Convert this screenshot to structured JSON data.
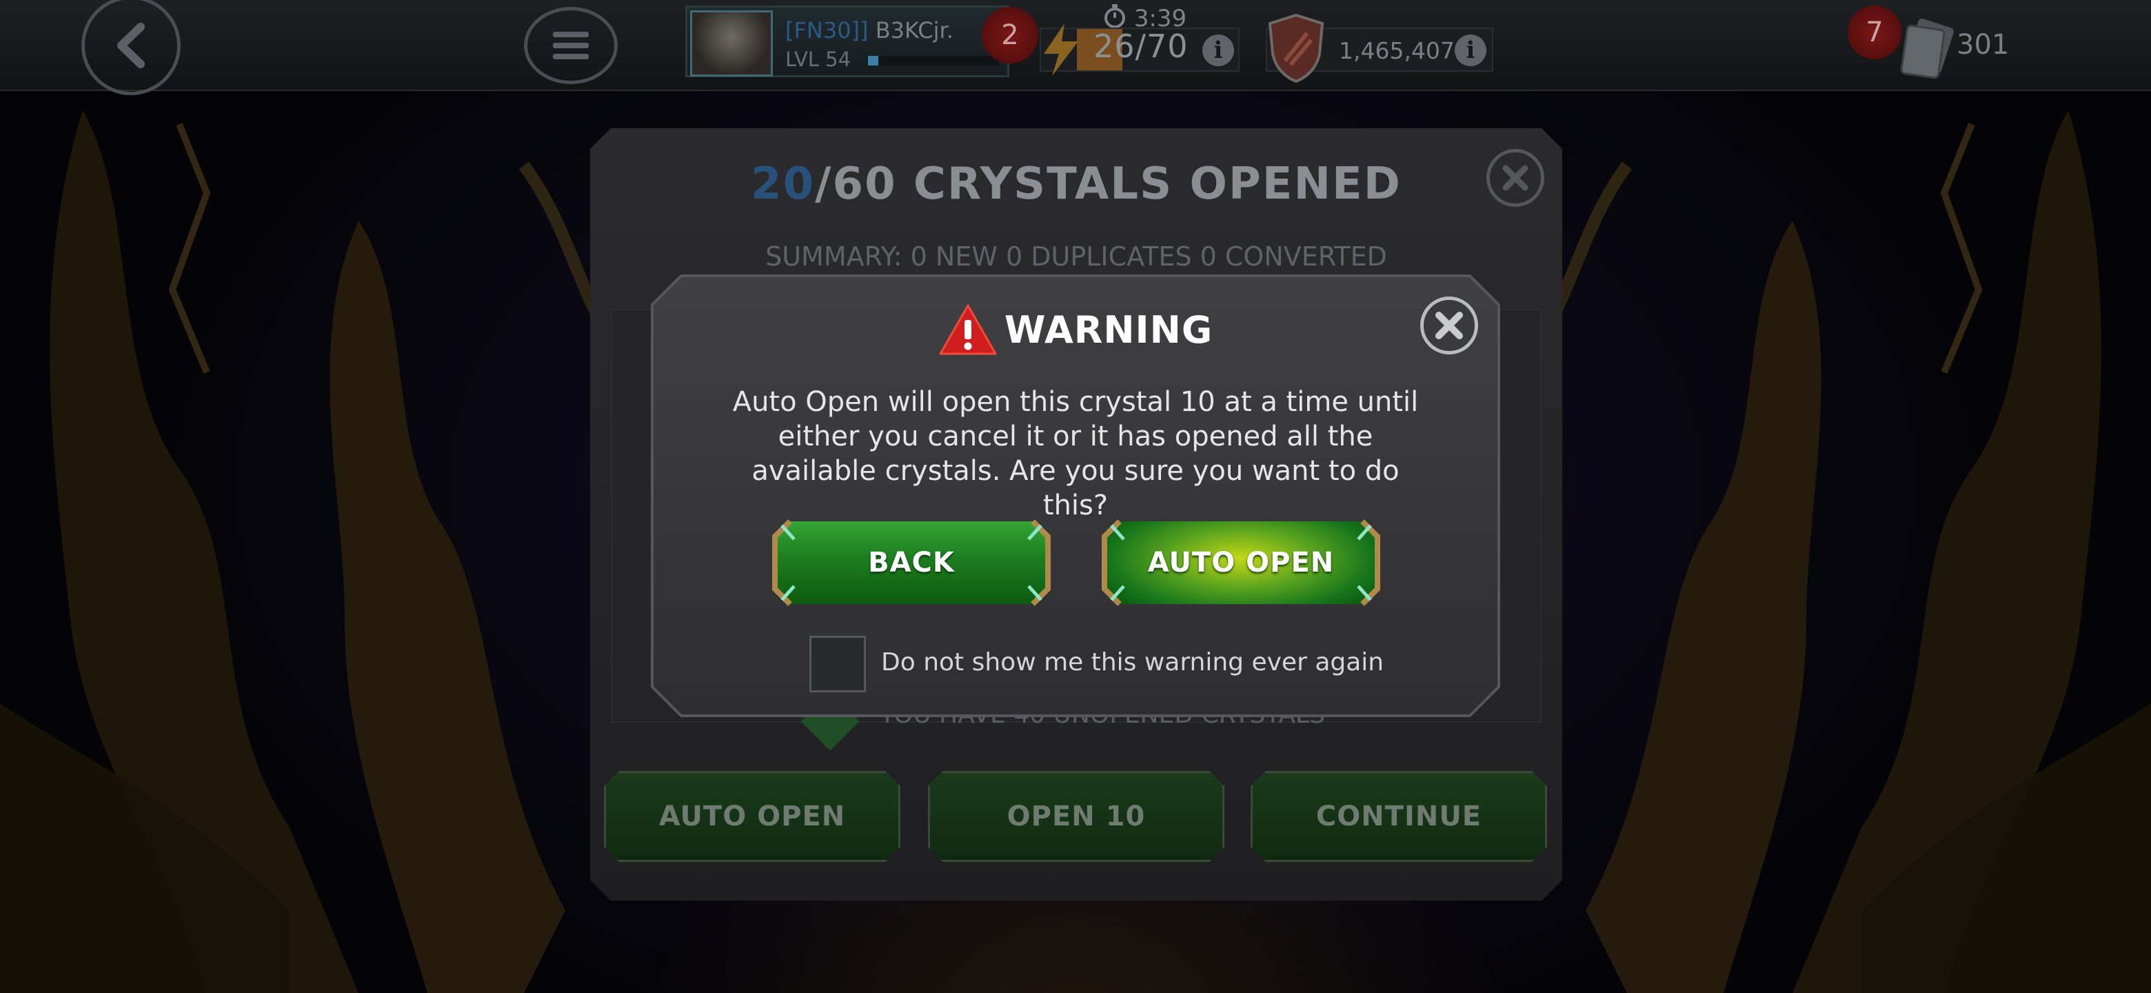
{
  "topbar": {
    "player": {
      "alliance_tag": "[FN30]]",
      "name": "B3KCjr.",
      "level": "LVL 54",
      "xp_fraction": 0.08,
      "notifications": "2"
    },
    "energy": {
      "timer": "3:39",
      "value": "26/70"
    },
    "units": {
      "value": "1,465,407"
    },
    "cards": {
      "badge": "7",
      "value": "301"
    }
  },
  "panel": {
    "title_count": "20",
    "title_rest": "/60 CRYSTALS OPENED",
    "summary": "SUMMARY: 0 NEW 0 DUPLICATES 0 CONVERTED",
    "unopened_text": "YOU HAVE 40 UNOPENED CRYSTALS",
    "buttons": [
      "AUTO OPEN",
      "OPEN 10",
      "CONTINUE"
    ]
  },
  "warning": {
    "title": "WARNING",
    "body": "Auto Open will open this crystal 10 at a time until either you cancel it or it has opened all the available crystals. Are you sure you want to do this?",
    "back_label": "BACK",
    "auto_open_label": "AUTO OPEN",
    "checkbox_label": "Do not show me this warning ever again",
    "checkbox_checked": false
  },
  "icons": {
    "back": "chevron-left-icon",
    "menu": "hamburger-menu-icon",
    "energy": "lightning-bolt-icon",
    "units": "shield-icon",
    "info": "info-icon",
    "cards": "cards-icon",
    "warning": "warning-triangle-icon",
    "close": "close-icon"
  },
  "colors": {
    "accent_green": "#1c7d1f",
    "highlight_yellow_green": "#c5d816",
    "badge_red": "#7a1616",
    "title_blue": "#27507a"
  }
}
